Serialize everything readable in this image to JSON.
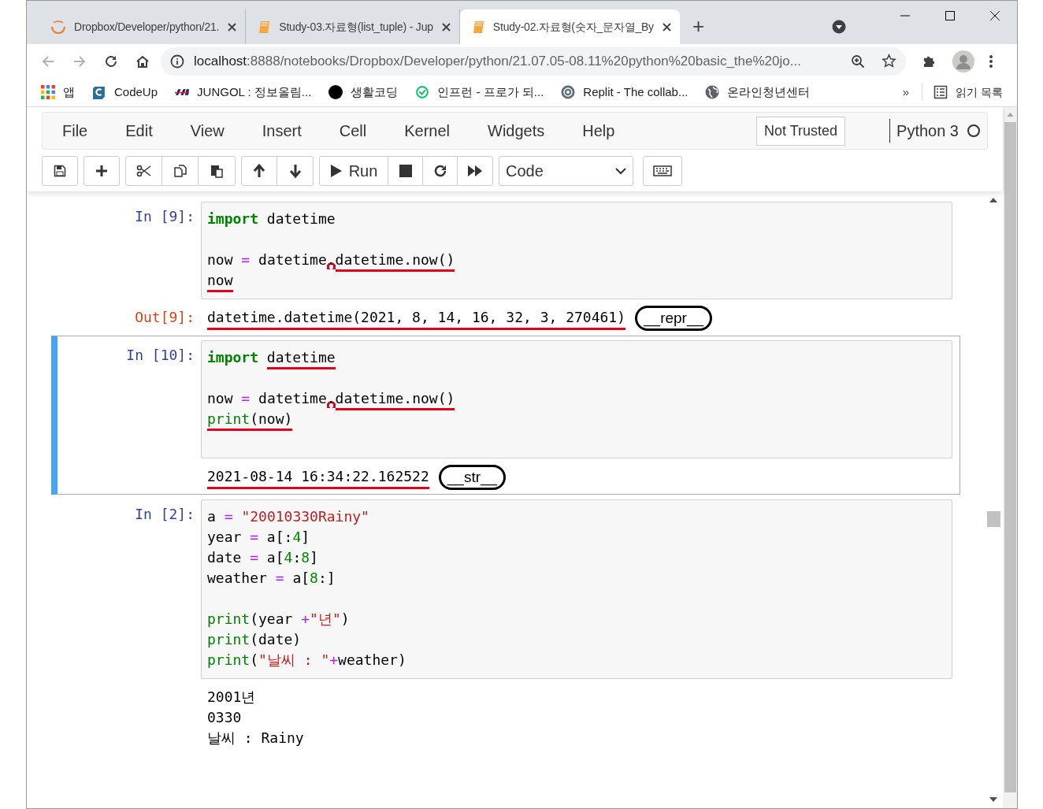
{
  "browser": {
    "tabs": [
      {
        "title": "Dropbox/Developer/python/21.",
        "selected": false
      },
      {
        "title": "Study-03.자료형(list_tuple) - Jup",
        "selected": false
      },
      {
        "title": "Study-02.자료형(숫자_문자열_By",
        "selected": true
      }
    ],
    "new_tab": "+",
    "address": {
      "host": "localhost",
      "path": ":8888/notebooks/Dropbox/Developer/python/21.07.05-08.11%20python%20basic_the%20jo..."
    },
    "bookmarks": [
      {
        "label": "앱",
        "kind": "apps"
      },
      {
        "label": "CodeUp",
        "kind": "codeup"
      },
      {
        "label": "JUNGOL : 정보올림...",
        "kind": "jungol"
      },
      {
        "label": "생활코딩",
        "kind": "dot"
      },
      {
        "label": "인프런 - 프로가 되...",
        "kind": "inflearn"
      },
      {
        "label": "Replit - The collab...",
        "kind": "replit"
      },
      {
        "label": "온라인청년센터",
        "kind": "globe"
      }
    ],
    "more_bookmarks": "»",
    "reading_list": "읽기 목록"
  },
  "jupyter": {
    "menu": [
      "File",
      "Edit",
      "View",
      "Insert",
      "Cell",
      "Kernel",
      "Widgets",
      "Help"
    ],
    "trust": "Not Trusted",
    "kernel": "Python 3",
    "toolbar": {
      "run": "Run",
      "cell_type": "Code"
    }
  },
  "cells": [
    {
      "prompt": "In [9]:",
      "selected": false,
      "input": [
        {
          "kind": "code",
          "tokens": [
            {
              "text": "import ",
              "kind": "keyword",
              "underlined": false
            },
            {
              "text": "datetime",
              "kind": "name",
              "underlined": false
            }
          ]
        },
        {
          "kind": "blank"
        },
        {
          "kind": "code",
          "tokens": [
            {
              "text": "now ",
              "kind": "name",
              "underlined": false
            },
            {
              "text": "=",
              "kind": "operator",
              "underlined": false
            },
            {
              "text": " datetime",
              "kind": "name",
              "underlined": false
            },
            {
              "text": ".",
              "kind": "circled",
              "underlined": false
            },
            {
              "text": "datetime.now()",
              "kind": "name",
              "underlined": true
            }
          ]
        },
        {
          "kind": "code",
          "tokens": [
            {
              "text": "now",
              "kind": "name",
              "underlined": true
            }
          ]
        }
      ],
      "output_prompt": "Out[9]:",
      "output": [
        {
          "text": "datetime.datetime(2021, 8, 14, 16, 32, 3, 270461)",
          "underlined": true
        }
      ],
      "note": "__repr__"
    },
    {
      "prompt": "In [10]:",
      "selected": true,
      "input": [
        {
          "kind": "code",
          "tokens": [
            {
              "text": "import ",
              "kind": "keyword",
              "underlined": false
            },
            {
              "text": "datetime",
              "kind": "name",
              "underlined": true
            }
          ]
        },
        {
          "kind": "blank"
        },
        {
          "kind": "code",
          "tokens": [
            {
              "text": "now ",
              "kind": "name",
              "underlined": false
            },
            {
              "text": "=",
              "kind": "operator",
              "underlined": false
            },
            {
              "text": " datetime",
              "kind": "name",
              "underlined": false
            },
            {
              "text": ".",
              "kind": "circled",
              "underlined": false
            },
            {
              "text": "datetime.now()",
              "kind": "name",
              "underlined": true
            }
          ]
        },
        {
          "kind": "code",
          "tokens": [
            {
              "text": "print",
              "kind": "builtin",
              "underlined": true
            },
            {
              "text": "(now)",
              "kind": "name",
              "underlined": true
            }
          ]
        },
        {
          "kind": "blank"
        }
      ],
      "output": [
        {
          "text": "2021-08-14 16:34:22.162522",
          "underlined": true
        }
      ],
      "note": "__str__"
    },
    {
      "prompt": "In [2]:",
      "selected": false,
      "input": [
        {
          "kind": "code",
          "tokens": [
            {
              "text": "a ",
              "kind": "name",
              "underlined": false
            },
            {
              "text": "= ",
              "kind": "operator",
              "underlined": false
            },
            {
              "text": "\"20010330Rainy\"",
              "kind": "string",
              "underlined": false
            }
          ]
        },
        {
          "kind": "code",
          "tokens": [
            {
              "text": "year ",
              "kind": "name",
              "underlined": false
            },
            {
              "text": "=",
              "kind": "operator",
              "underlined": false
            },
            {
              "text": " a[:",
              "kind": "name",
              "underlined": false
            },
            {
              "text": "4",
              "kind": "number",
              "underlined": false
            },
            {
              "text": "]",
              "kind": "name",
              "underlined": false
            }
          ]
        },
        {
          "kind": "code",
          "tokens": [
            {
              "text": "date ",
              "kind": "name",
              "underlined": false
            },
            {
              "text": "=",
              "kind": "operator",
              "underlined": false
            },
            {
              "text": " a[",
              "kind": "name",
              "underlined": false
            },
            {
              "text": "4",
              "kind": "number",
              "underlined": false
            },
            {
              "text": ":",
              "kind": "name",
              "underlined": false
            },
            {
              "text": "8",
              "kind": "number",
              "underlined": false
            },
            {
              "text": "]",
              "kind": "name",
              "underlined": false
            }
          ]
        },
        {
          "kind": "code",
          "tokens": [
            {
              "text": "weather ",
              "kind": "name",
              "underlined": false
            },
            {
              "text": "=",
              "kind": "operator",
              "underlined": false
            },
            {
              "text": " a[",
              "kind": "name",
              "underlined": false
            },
            {
              "text": "8",
              "kind": "number",
              "underlined": false
            },
            {
              "text": ":]",
              "kind": "name",
              "underlined": false
            }
          ]
        },
        {
          "kind": "blank"
        },
        {
          "kind": "code",
          "tokens": [
            {
              "text": "print",
              "kind": "builtin",
              "underlined": false
            },
            {
              "text": "(year ",
              "kind": "name",
              "underlined": false
            },
            {
              "text": "+",
              "kind": "operator",
              "underlined": false
            },
            {
              "text": "\"년\"",
              "kind": "string",
              "underlined": false
            },
            {
              "text": ")",
              "kind": "name",
              "underlined": false
            }
          ]
        },
        {
          "kind": "code",
          "tokens": [
            {
              "text": "print",
              "kind": "builtin",
              "underlined": false
            },
            {
              "text": "(date)",
              "kind": "name",
              "underlined": false
            }
          ]
        },
        {
          "kind": "code",
          "tokens": [
            {
              "text": "print",
              "kind": "builtin",
              "underlined": false
            },
            {
              "text": "(",
              "kind": "name",
              "underlined": false
            },
            {
              "text": "\"날씨 : \"",
              "kind": "string",
              "underlined": false
            },
            {
              "text": "+",
              "kind": "operator",
              "underlined": false
            },
            {
              "text": "weather)",
              "kind": "name",
              "underlined": false
            }
          ]
        }
      ],
      "output": [
        {
          "text": "2001년",
          "underlined": false
        },
        {
          "text": "0330",
          "underlined": false
        },
        {
          "text": "날씨 : Rainy",
          "underlined": false
        }
      ]
    }
  ]
}
